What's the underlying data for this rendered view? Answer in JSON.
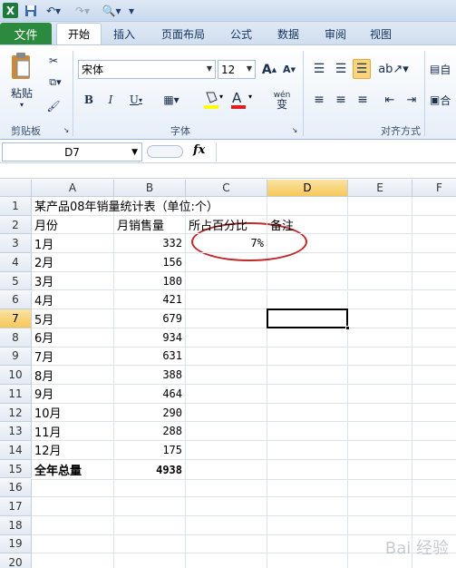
{
  "qat": {
    "logo_letter": "X"
  },
  "tabs": [
    {
      "label": "文件"
    },
    {
      "label": "开始"
    },
    {
      "label": "插入"
    },
    {
      "label": "页面布局"
    },
    {
      "label": "公式"
    },
    {
      "label": "数据"
    },
    {
      "label": "审阅"
    },
    {
      "label": "视图"
    }
  ],
  "ribbon": {
    "paste_label": "粘贴",
    "clipboard_label": "剪贴板",
    "font_group_label": "字体",
    "align_group_label": "对齐方式",
    "font_name": "宋体",
    "font_size": "12",
    "bold": "B",
    "italic": "I",
    "underline": "U",
    "grow_font": "A",
    "shrink_font": "A",
    "wen": "wén",
    "wen_char": "变",
    "wrap_partial": "自",
    "merge_partial": "合"
  },
  "formula_bar": {
    "name_box": "D7",
    "fx": "fx",
    "value": ""
  },
  "columns": [
    "A",
    "B",
    "C",
    "D",
    "E",
    "F"
  ],
  "rows": [
    "1",
    "2",
    "3",
    "4",
    "5",
    "6",
    "7",
    "8",
    "9",
    "10",
    "11",
    "12",
    "13",
    "14",
    "15",
    "16",
    "17",
    "18",
    "19",
    "20"
  ],
  "sheet": {
    "title": "某产品08年销量统计表（单位:个）",
    "header_month": "月份",
    "header_sales": "月销售量",
    "header_pct": "所占百分比",
    "header_note": "备注",
    "data": [
      {
        "month": "1月",
        "sales": "332",
        "pct": "7%"
      },
      {
        "month": "2月",
        "sales": "156"
      },
      {
        "month": "3月",
        "sales": "180"
      },
      {
        "month": "4月",
        "sales": "421"
      },
      {
        "month": "5月",
        "sales": "679"
      },
      {
        "month": "6月",
        "sales": "934"
      },
      {
        "month": "7月",
        "sales": "631"
      },
      {
        "month": "8月",
        "sales": "388"
      },
      {
        "month": "9月",
        "sales": "464"
      },
      {
        "month": "10月",
        "sales": "290"
      },
      {
        "month": "11月",
        "sales": "288"
      },
      {
        "month": "12月",
        "sales": "175"
      }
    ],
    "total_label": "全年总量",
    "total_value": "4938"
  },
  "active_cell": "D7",
  "colors": {
    "accent": "#2b8a3e",
    "selection": "#f6c858",
    "annotation": "#c0282a"
  },
  "watermark": "Bai 经验"
}
